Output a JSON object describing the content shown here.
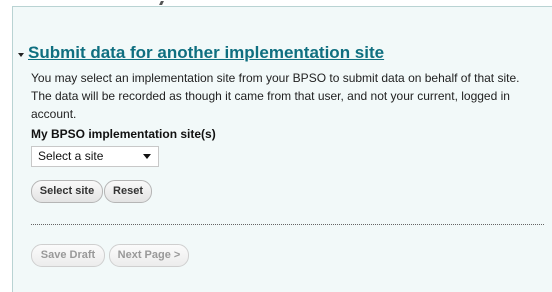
{
  "section": {
    "title": "Submit data for another implementation site",
    "description": "You may select an implementation site from your BPSO to submit data on behalf of that site. The data will be recorded as though it came from that user, and not your current, logged in account."
  },
  "site_field": {
    "label": "My BPSO implementation site(s)",
    "selected_value": "Select a site"
  },
  "buttons": {
    "select_site": "Select site",
    "reset": "Reset",
    "save_draft": "Save Draft",
    "next_page": "Next Page >"
  }
}
